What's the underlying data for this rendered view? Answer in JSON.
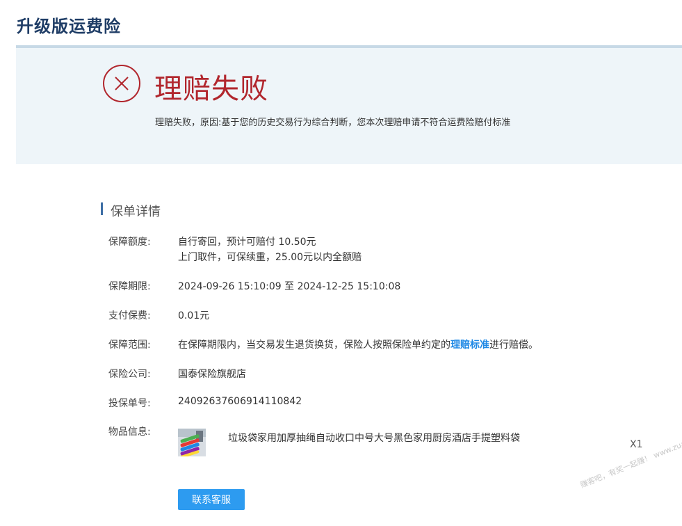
{
  "page": {
    "title": "升级版运费险"
  },
  "status": {
    "title": "理赔失败",
    "reason": "理赔失败，原因:基于您的历史交易行为综合判断，您本次理赔申请不符合运费险赔付标准",
    "icon": "close-circle-icon",
    "color": "#b1262d"
  },
  "section": {
    "title": "保单详情"
  },
  "details": {
    "coverage_label": "保障额度:",
    "coverage_line1": "自行寄回，预计可赔付 10.50元",
    "coverage_line2": "上门取件，可保续重，25.00元以内全额赔",
    "period_label": "保障期限:",
    "period_value": "2024-09-26 15:10:09 至 2024-12-25 15:10:08",
    "premium_label": "支付保费:",
    "premium_value": "0.01元",
    "scope_label": "保障范围:",
    "scope_before": "在保障期限内，当交易发生退货换货，保险人按照保险单约定的",
    "scope_link": "理赔标准",
    "scope_after": "进行赔偿。",
    "company_label": "保险公司:",
    "company_value": "国泰保险旗舰店",
    "policy_label": "投保单号:",
    "policy_value": "24092637606914110842",
    "goods_label": "物品信息:"
  },
  "goods": {
    "name": "垃圾袋家用加厚抽绳自动收口中号大号黑色家用厨房酒店手提塑料袋",
    "qty": "X1"
  },
  "actions": {
    "contact": "联系客服"
  },
  "watermark": "赚客吧，有奖一起赚！ www.zuanke8.com",
  "colors": {
    "accent": "#2d9bf0",
    "highlight": "#e8804a",
    "title": "#1f3d66"
  }
}
